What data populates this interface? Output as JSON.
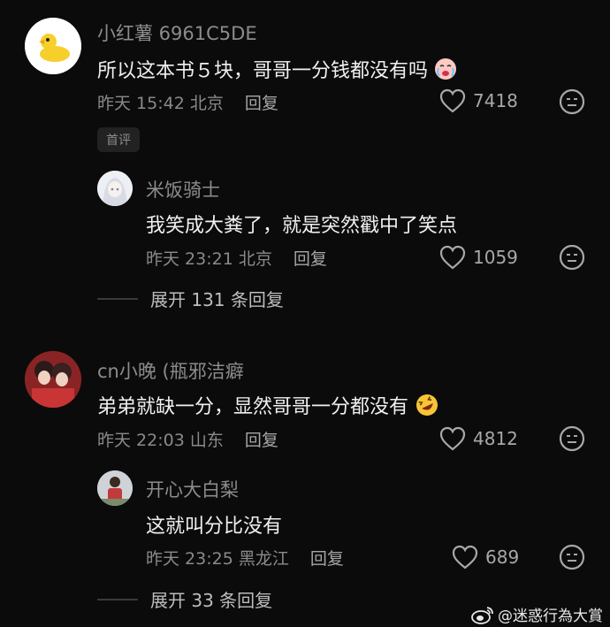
{
  "comments": [
    {
      "user": "小红薯 6961C5DE",
      "text": "所以这本书５块，哥哥一分钱都没有吗",
      "time": "昨天 15:42 北京",
      "reply_label": "回复",
      "likes": "7418",
      "badge": "首评",
      "replies": [
        {
          "user": "米饭骑士",
          "text": "我笑成大粪了，就是突然戳中了笑点",
          "time": "昨天 23:21 北京",
          "reply_label": "回复",
          "likes": "1059"
        }
      ],
      "expand": "展开 131 条回复"
    },
    {
      "user": "cn小晚 (瓶邪洁癖",
      "text": "弟弟就缺一分，显然哥哥一分都没有",
      "time": "昨天 22:03 山东",
      "reply_label": "回复",
      "likes": "4812",
      "replies": [
        {
          "user": "开心大白梨",
          "text": "这就叫分比没有",
          "time": "昨天 23:25 黑龙江",
          "reply_label": "回复",
          "likes": "689"
        }
      ],
      "expand": "展开 33 条回复"
    }
  ],
  "watermark": "@迷惑行為大賞",
  "icons": {
    "heart": "heart-outline-icon",
    "face": "meh-face-icon",
    "emoji1": "crying-face-emoji",
    "emoji2": "rofl-face-emoji",
    "weibo": "weibo-logo"
  }
}
